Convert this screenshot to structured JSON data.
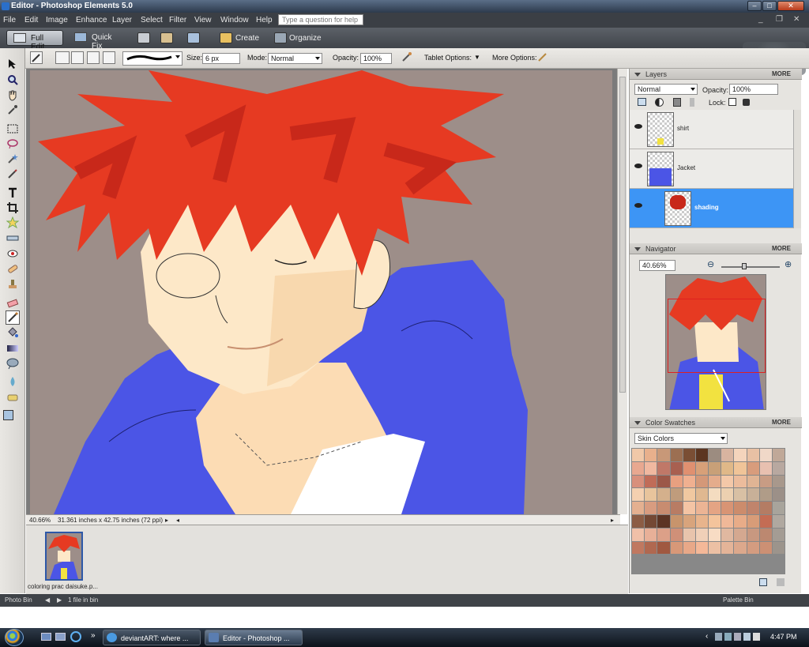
{
  "window": {
    "title": "Editor - Photoshop Elements 5.0"
  },
  "menu": {
    "items": [
      "File",
      "Edit",
      "Image",
      "Enhance",
      "Layer",
      "Select",
      "Filter",
      "View",
      "Window",
      "Help"
    ],
    "help_placeholder": "Type a question for help"
  },
  "modebar": {
    "full_edit": "Full Edit",
    "quick_fix": "Quick Fix",
    "create": "Create",
    "organize": "Organize"
  },
  "options": {
    "size_label": "Size:",
    "size_value": "6 px",
    "mode_label": "Mode:",
    "mode_value": "Normal",
    "opacity_label": "Opacity:",
    "opacity_value": "100%",
    "tablet_label": "Tablet Options:",
    "more_label": "More Options:"
  },
  "status": {
    "zoom": "40.66%",
    "doc_size": "31.361 inches x 42.75 inches (72 ppi)"
  },
  "bin": {
    "file_label": "coloring prac daisuke.p...",
    "photo_bin": "Photo Bin",
    "count": "1 file in bin",
    "palette_bin": "Palette Bin"
  },
  "layers_panel": {
    "title": "Layers",
    "more": "MORE",
    "blend": "Normal",
    "opacity_label": "Opacity:",
    "opacity_value": "100%",
    "lock_label": "Lock:",
    "layers": [
      {
        "name": "shirt",
        "selected": false
      },
      {
        "name": "Jacket",
        "selected": false
      },
      {
        "name": "shading",
        "selected": true
      }
    ]
  },
  "navigator": {
    "title": "Navigator",
    "more": "MORE",
    "zoom": "40.66%"
  },
  "swatches_panel": {
    "title": "Color Swatches",
    "more": "MORE",
    "set": "Skin Colors",
    "colors": [
      "#f0c8a8",
      "#e8b08c",
      "#c89878",
      "#9c6f52",
      "#7a4e34",
      "#5c3520",
      "#9c8c80",
      "#d8b4a0",
      "#f4d4bc",
      "#e8c0a4",
      "#f0d8c8",
      "#c0a898",
      "#e8a890",
      "#f0b8a0",
      "#c07868",
      "#a86050",
      "#e09070",
      "#d8a078",
      "#c8a078",
      "#e0b888",
      "#f0c498",
      "#d89c7c",
      "#e8c0b0",
      "#b8a8a0",
      "#d8907c",
      "#c06c58",
      "#9c5848",
      "#e8a080",
      "#f0b090",
      "#d49878",
      "#e4ac8c",
      "#f4c8a8",
      "#ecbc9c",
      "#e0b494",
      "#c89c84",
      "#a8988c",
      "#f4d0b0",
      "#e8c49c",
      "#d4b08c",
      "#c09c7c",
      "#f0c8a0",
      "#e0b890",
      "#f4dcc0",
      "#ecd0b0",
      "#d8c0a4",
      "#c8b098",
      "#b09c88",
      "#9c9088",
      "#e4b090",
      "#d89c80",
      "#c88c70",
      "#b87c64",
      "#f4c4a4",
      "#ecb494",
      "#e4a484",
      "#d89474",
      "#cc8c6c",
      "#c0846c",
      "#b47c64",
      "#a8a49c",
      "#8c5c44",
      "#744834",
      "#5c3424",
      "#c8946c",
      "#d8a47c",
      "#e8b48c",
      "#f4c49c",
      "#f0b898",
      "#e8ac88",
      "#d89c78",
      "#c46c54",
      "#b0a8a0",
      "#f0c0a8",
      "#e8b098",
      "#dca088",
      "#d09078",
      "#e8c4ac",
      "#f0d0b8",
      "#f8dcc4",
      "#e0b8a0",
      "#d4a890",
      "#c89880",
      "#bc8870",
      "#a49c94",
      "#c07860",
      "#b06850",
      "#a05840",
      "#d89878",
      "#e8a888",
      "#f4b898",
      "#ecc0a4",
      "#e4b498",
      "#dca88c",
      "#d49c80",
      "#cc9074",
      "#9c948c"
    ]
  },
  "taskbar": {
    "btn1": "deviantART: where ...",
    "btn2": "Editor - Photoshop ...",
    "clock": "4:47 PM"
  }
}
